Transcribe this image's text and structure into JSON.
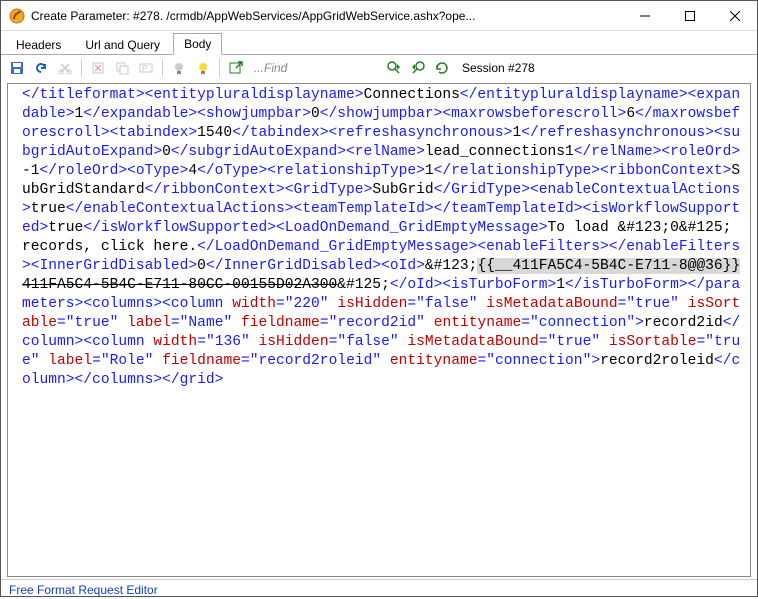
{
  "window": {
    "title": "Create Parameter: #278. /crmdb/AppWebServices/AppGridWebService.ashx?ope..."
  },
  "tabs": {
    "items": [
      {
        "label": "Headers",
        "active": false
      },
      {
        "label": "Url and Query",
        "active": false
      },
      {
        "label": "Body",
        "active": true
      }
    ]
  },
  "toolbar": {
    "find_placeholder": "...Find",
    "session_label": "Session #278"
  },
  "statusbar": {
    "text": "Free Format Request Editor"
  },
  "body_xml": {
    "segments": [
      {
        "tag_close": "titleformat"
      },
      {
        "tag_open": "entitypluraldisplayname"
      },
      {
        "text": "Connections"
      },
      {
        "tag_close": "entitypluraldisplayname"
      },
      {
        "tag_open": "expandable"
      },
      {
        "text": "1"
      },
      {
        "tag_close": "expandable"
      },
      {
        "tag_open": "showjumpbar"
      },
      {
        "text": "0"
      },
      {
        "tag_close": "showjumpbar"
      },
      {
        "tag_open": "maxrowsbeforescroll"
      },
      {
        "text": "6"
      },
      {
        "tag_close": "maxrowsbeforescroll"
      },
      {
        "tag_open": "tabindex"
      },
      {
        "text": "1540"
      },
      {
        "tag_close": "tabindex"
      },
      {
        "tag_open": "refreshasynchronous"
      },
      {
        "text": "1"
      },
      {
        "tag_close": "refreshasynchronous"
      },
      {
        "tag_open": "subgridAutoExpand"
      },
      {
        "text": "0"
      },
      {
        "tag_close": "subgridAutoExpand"
      },
      {
        "tag_open": "relName"
      },
      {
        "text": "lead_connections1"
      },
      {
        "tag_close": "relName"
      },
      {
        "tag_open": "roleOrd"
      },
      {
        "text": "-1"
      },
      {
        "tag_close": "roleOrd"
      },
      {
        "tag_open": "oType"
      },
      {
        "text": "4"
      },
      {
        "tag_close": "oType"
      },
      {
        "tag_open": "relationshipType"
      },
      {
        "text": "1"
      },
      {
        "tag_close": "relationshipType"
      },
      {
        "tag_open": "ribbonContext"
      },
      {
        "text": "SubGridStandard"
      },
      {
        "tag_close": "ribbonContext"
      },
      {
        "tag_open": "GridType"
      },
      {
        "text": "SubGrid"
      },
      {
        "tag_close": "GridType"
      },
      {
        "tag_open": "enableContextualActions"
      },
      {
        "text": "true"
      },
      {
        "tag_close": "enableContextualActions"
      },
      {
        "tag_open": "teamTemplateId"
      },
      {
        "tag_close": "teamTemplateId"
      },
      {
        "tag_open": "isWorkflowSupported"
      },
      {
        "text": "true"
      },
      {
        "tag_close": "isWorkflowSupported"
      },
      {
        "tag_open": "LoadOnDemand_GridEmptyMessage"
      },
      {
        "text": "To load &#123;0&#125; records, click here."
      },
      {
        "tag_close": "LoadOnDemand_GridEmptyMessage"
      },
      {
        "tag_open": "enableFilters"
      },
      {
        "tag_close": "enableFilters"
      },
      {
        "tag_open": "InnerGridDisabled"
      },
      {
        "text": "0"
      },
      {
        "tag_close": "InnerGridDisabled"
      },
      {
        "tag_open": "oId"
      },
      {
        "text": "&#123;"
      },
      {
        "highlight": "{{__411FA5C4-5B4C-E711-8@@36}}"
      },
      {
        "strike": "411FA5C4-5B4C-E711-80CC-00155D02A300"
      },
      {
        "text": "&#125;"
      },
      {
        "tag_close": "oId"
      },
      {
        "tag_open": "isTurboForm"
      },
      {
        "text": "1"
      },
      {
        "tag_close": "isTurboForm"
      },
      {
        "tag_close": "parameters"
      },
      {
        "tag_open": "columns"
      },
      {
        "tag_open_attrs": {
          "name": "column",
          "attrs": [
            {
              "n": "width",
              "v": "\"220\""
            },
            {
              "n": "isHidden",
              "v": "\"false\""
            },
            {
              "n": "isMetadataBound",
              "v": "\"true\""
            },
            {
              "n": "isSortable",
              "v": "\"true\""
            },
            {
              "n": "label",
              "v": "\"Name\""
            },
            {
              "n": "fieldname",
              "v": "\"record2id\""
            },
            {
              "n": "entityname",
              "v": "\"connection\""
            }
          ]
        }
      },
      {
        "text": "record2id"
      },
      {
        "tag_close": "column"
      },
      {
        "tag_open_attrs": {
          "name": "column",
          "attrs": [
            {
              "n": "width",
              "v": "\"136\""
            },
            {
              "n": "isHidden",
              "v": "\"false\""
            },
            {
              "n": "isMetadataBound",
              "v": "\"true\""
            },
            {
              "n": "isSortable",
              "v": "\"true\""
            },
            {
              "n": "label",
              "v": "\"Role\""
            },
            {
              "n": "fieldname",
              "v": "\"record2roleid\""
            },
            {
              "n": "entityname",
              "v": "\"connection\""
            }
          ]
        }
      },
      {
        "text": "record2roleid"
      },
      {
        "tag_close": "column"
      },
      {
        "tag_close": "columns"
      },
      {
        "tag_close": "grid"
      }
    ]
  }
}
